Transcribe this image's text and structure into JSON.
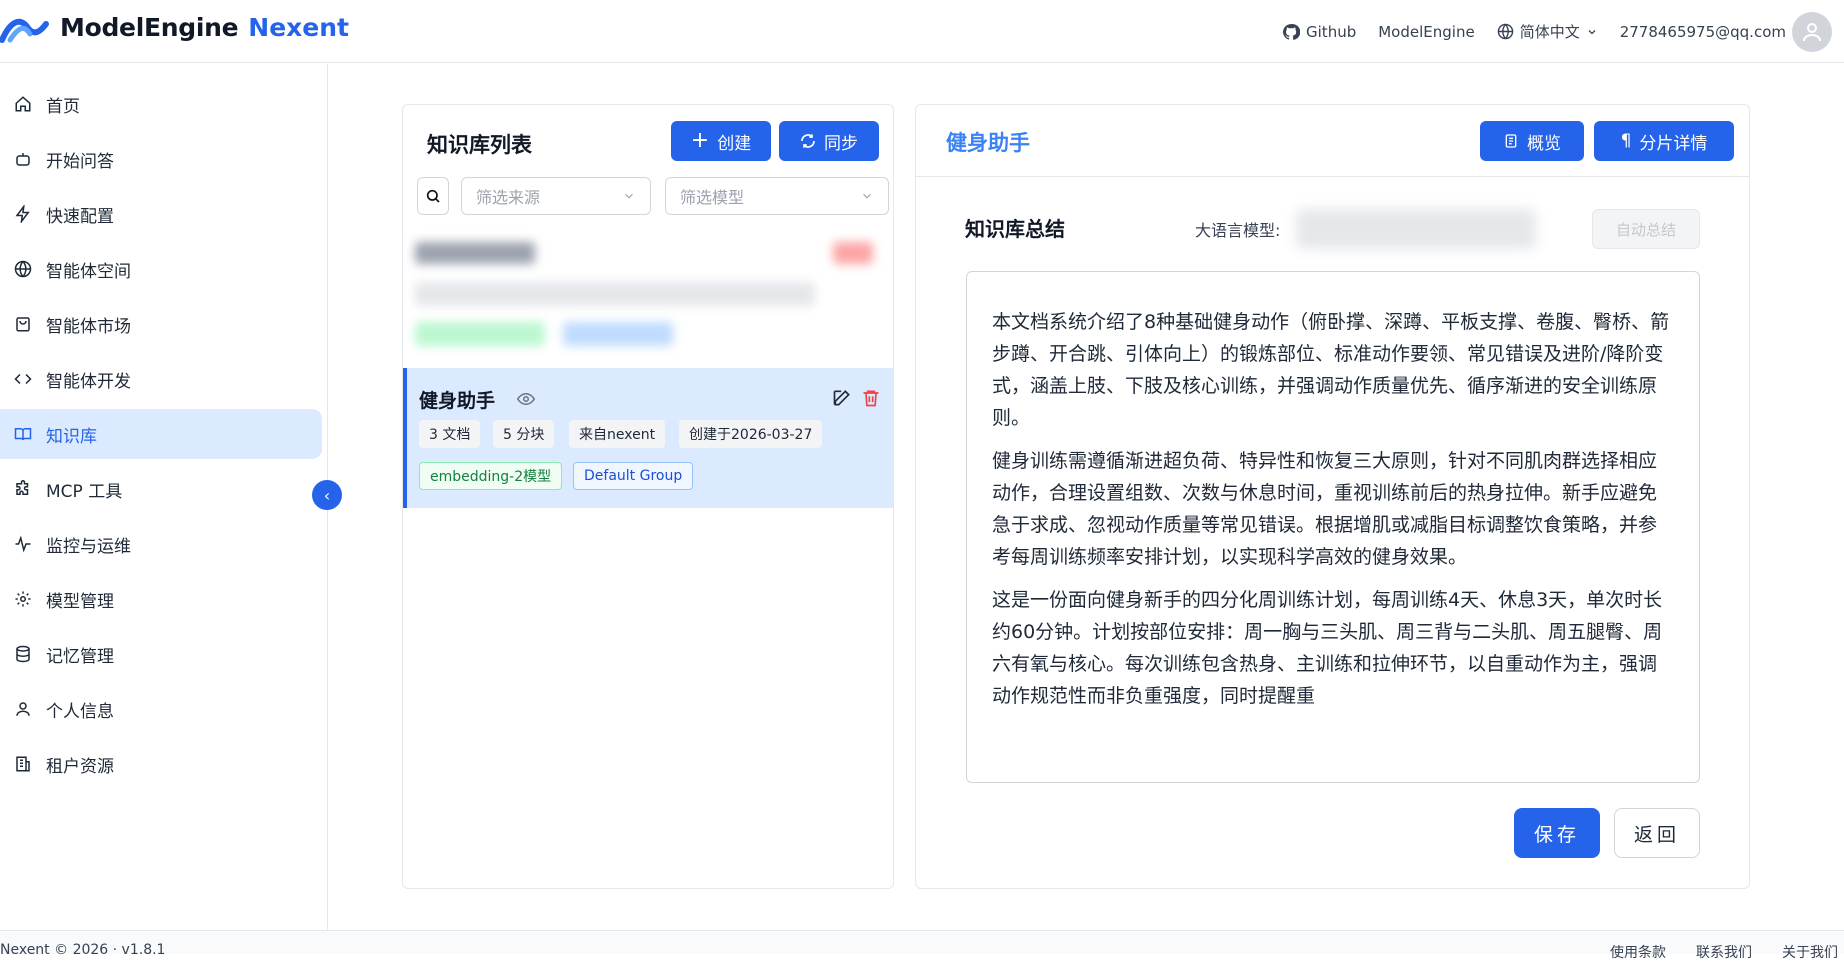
{
  "header": {
    "logo_text": "ModelEngine",
    "logo_sub": "Nexent",
    "github_label": "Github",
    "modelengine_label": "ModelEngine",
    "language_label": "简体中文",
    "user_email": "2778465975@qq.com"
  },
  "sidebar": {
    "items": [
      {
        "label": "首页",
        "icon": "home-icon"
      },
      {
        "label": "开始问答",
        "icon": "bot-icon"
      },
      {
        "label": "快速配置",
        "icon": "lightning-icon"
      },
      {
        "label": "智能体空间",
        "icon": "globe-icon"
      },
      {
        "label": "智能体市场",
        "icon": "shopping-bag-icon"
      },
      {
        "label": "智能体开发",
        "icon": "code-icon"
      },
      {
        "label": "知识库",
        "icon": "book-icon"
      },
      {
        "label": "MCP 工具",
        "icon": "puzzle-icon"
      },
      {
        "label": "监控与运维",
        "icon": "activity-icon"
      },
      {
        "label": "模型管理",
        "icon": "gear-icon"
      },
      {
        "label": "记忆管理",
        "icon": "database-icon"
      },
      {
        "label": "个人信息",
        "icon": "user-icon"
      },
      {
        "label": "租户资源",
        "icon": "building-icon"
      }
    ],
    "active_index": 6
  },
  "kb_list": {
    "title": "知识库列表",
    "create_label": "创建",
    "sync_label": "同步",
    "filter_source_placeholder": "筛选来源",
    "filter_model_placeholder": "筛选模型",
    "selected": {
      "name": "健身助手",
      "docs": "3 文档",
      "chunks": "5 分块",
      "source": "来自nexent",
      "created": "创建于2026-03-27",
      "model_tag": "embedding-2模型",
      "group_tag": "Default Group"
    }
  },
  "detail": {
    "title": "健身助手",
    "overview_label": "概览",
    "chunks_label": "分片详情",
    "summary_label": "知识库总结",
    "llm_label": "大语言模型:",
    "auto_summary_label": "自动总结",
    "summary_paragraphs": [
      "本文档系统介绍了8种基础健身动作（俯卧撑、深蹲、平板支撑、卷腹、臀桥、箭步蹲、开合跳、引体向上）的锻炼部位、标准动作要领、常见错误及进阶/降阶变式，涵盖上肢、下肢及核心训练，并强调动作质量优先、循序渐进的安全训练原则。",
      "健身训练需遵循渐进超负荷、特异性和恢复三大原则，针对不同肌肉群选择相应动作，合理设置组数、次数与休息时间，重视训练前后的热身拉伸。新手应避免急于求成、忽视动作质量等常见错误。根据增肌或减脂目标调整饮食策略，并参考每周训练频率安排计划，以实现科学高效的健身效果。",
      "这是一份面向健身新手的四分化周训练计划，每周训练4天、休息3天，单次时长约60分钟。计划按部位安排：周一胸与三头肌、周三背与二头肌、周五腿臀、周六有氧与核心。每次训练包含热身、主训练和拉伸环节，以自重动作为主，强调动作规范性而非负重强度，同时提醒重"
    ],
    "save_label": "保存",
    "back_label": "返回"
  },
  "footer": {
    "copyright": "Nexent © 2026 · v1.8.1",
    "links": [
      "使用条款",
      "联系我们",
      "关于我们"
    ]
  },
  "colors": {
    "primary": "#2563eb",
    "active_bg": "#dbeafe",
    "delete": "#ef4444"
  }
}
